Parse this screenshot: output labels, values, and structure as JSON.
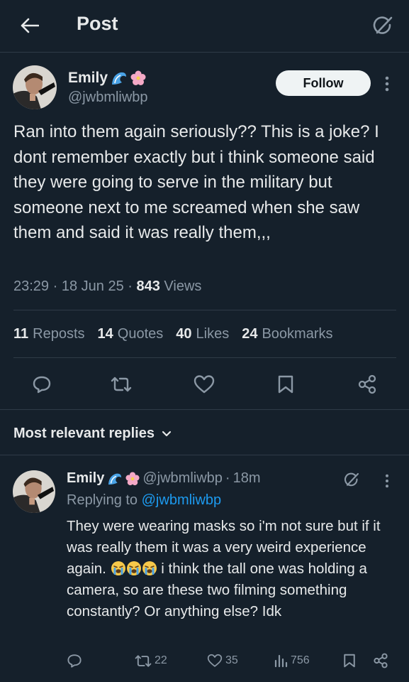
{
  "header": {
    "title": "Post"
  },
  "post": {
    "author": {
      "name": "Emily",
      "handle": "@jwbmliwbp"
    },
    "follow_label": "Follow",
    "text": "Ran into them again seriously?? This is a joke? I dont remember exactly but i think someone said they were going to serve in the military but someone next to me screamed when she saw them and said it was really them,,,",
    "time": "23:29",
    "date": "18 Jun 25",
    "views_count": "843",
    "views_label": "Views",
    "stats": [
      {
        "count": "11",
        "label": "Reposts"
      },
      {
        "count": "14",
        "label": "Quotes"
      },
      {
        "count": "40",
        "label": "Likes"
      },
      {
        "count": "24",
        "label": "Bookmarks"
      }
    ]
  },
  "replies_filter": {
    "label": "Most relevant replies"
  },
  "reply": {
    "author": {
      "name": "Emily",
      "handle": "@jwbmliwbp"
    },
    "age": "18m",
    "replying_prefix": "Replying to",
    "replying_handle": "@jwbmliwbp",
    "text_before": "They were wearing masks so i'm not sure but if it was really them it was a very weird experience again.",
    "text_after": "i think the tall one was holding a camera, so are these two filming something constantly? Or anything else? Idk",
    "emoji": [
      "loudly-crying-face",
      "loudly-crying-face",
      "loudly-crying-face"
    ],
    "counts": {
      "reposts": "22",
      "likes": "35",
      "views": "756"
    }
  },
  "colors": {
    "background": "#15202b",
    "text": "#e7e9ea",
    "muted": "#8b98a5",
    "accent": "#1d9bf0",
    "divider": "#2f3b47"
  }
}
